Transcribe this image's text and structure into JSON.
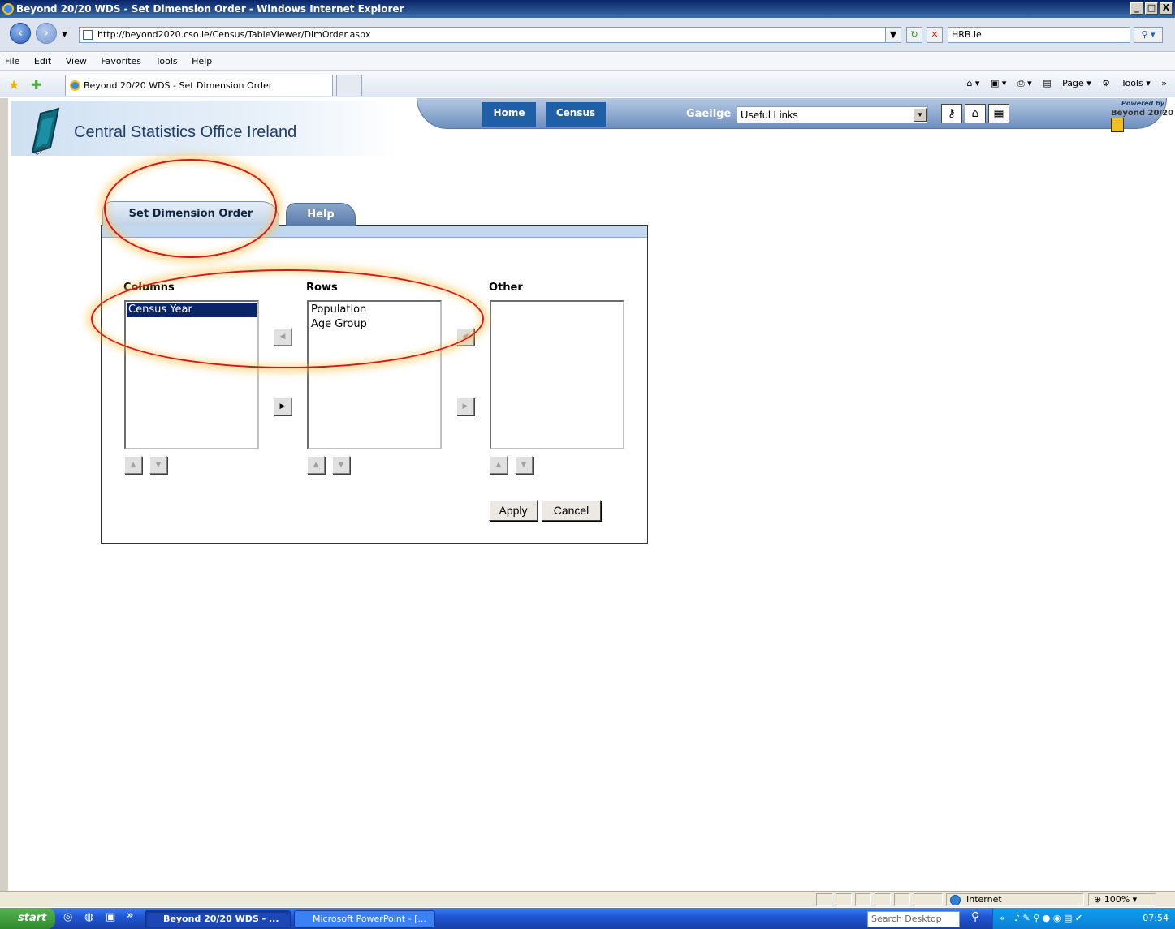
{
  "window": {
    "title": "Beyond 20/20 WDS - Set Dimension Order - Windows Internet Explorer",
    "min": "_",
    "max": "□",
    "close": "X"
  },
  "address": {
    "url": "http://beyond2020.cso.ie/Census/TableViewer/DimOrder.aspx",
    "search_value": "HRB.ie"
  },
  "menu": [
    "File",
    "Edit",
    "View",
    "Favorites",
    "Tools",
    "Help"
  ],
  "browser_tab": {
    "label": "Beyond 20/20 WDS - Set Dimension Order"
  },
  "command_bar": {
    "page": "Page",
    "tools": "Tools"
  },
  "site": {
    "org_name": "Central Statistics Office Ireland",
    "nav": {
      "home": "Home",
      "census": "Census"
    },
    "gaeilge": "Gaeilge",
    "links_select": "Useful Links",
    "powered_by": "Powered by",
    "beyond_logo": "Beyond 20/20"
  },
  "dialog": {
    "tabs": {
      "active": "Set Dimension Order",
      "help": "Help"
    },
    "columns": {
      "label": "Columns",
      "items": [
        "Census Year"
      ]
    },
    "rows": {
      "label": "Rows",
      "items": [
        "Population",
        "Age Group"
      ]
    },
    "other": {
      "label": "Other",
      "items": []
    },
    "apply": "Apply",
    "cancel": "Cancel"
  },
  "statusbar": {
    "zone": "Internet",
    "zoom": "100%"
  },
  "taskbar": {
    "start": "start",
    "tasks": [
      "Beyond 20/20 WDS - ...",
      "Microsoft PowerPoint - [..."
    ],
    "search_placeholder": "Search Desktop",
    "clock": "07:54"
  },
  "annotation_color": "#d9141c"
}
